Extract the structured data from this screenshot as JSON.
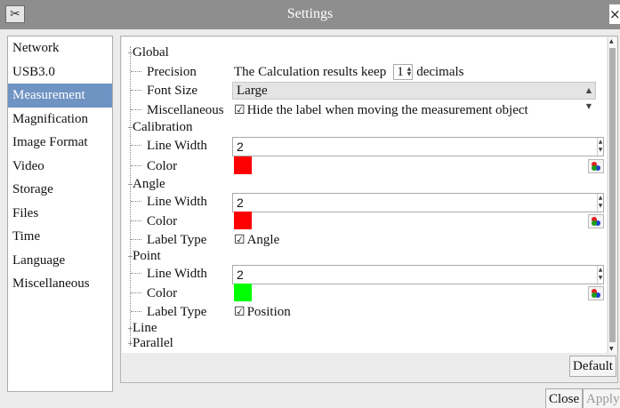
{
  "window": {
    "title": "Settings",
    "sys_icon": "tools-icon",
    "close_glyph": "×"
  },
  "sidebar": {
    "items": [
      {
        "label": "Network"
      },
      {
        "label": "USB3.0"
      },
      {
        "label": "Measurement",
        "selected": true
      },
      {
        "label": "Magnification"
      },
      {
        "label": "Image Format"
      },
      {
        "label": "Video"
      },
      {
        "label": "Storage"
      },
      {
        "label": "Files"
      },
      {
        "label": "Time"
      },
      {
        "label": "Language"
      },
      {
        "label": "Miscellaneous"
      }
    ]
  },
  "global": {
    "title": "Global",
    "precision_label": "Precision",
    "precision_text": "The Calculation results keep",
    "precision_value": "1",
    "precision_unit": "decimals",
    "font_size_label": "Font Size",
    "font_size_value": "Large",
    "misc_label": "Miscellaneous",
    "misc_check": "☑",
    "misc_text": "Hide the label when moving the measurement object"
  },
  "calibration": {
    "title": "Calibration",
    "line_width_label": "Line Width",
    "line_width_value": "2",
    "color_label": "Color",
    "color": "#ff0000"
  },
  "angle": {
    "title": "Angle",
    "line_width_label": "Line Width",
    "line_width_value": "2",
    "color_label": "Color",
    "color": "#ff0000",
    "label_type_label": "Label Type",
    "label_check": "☑",
    "label_type_value": "Angle"
  },
  "point": {
    "title": "Point",
    "line_width_label": "Line Width",
    "line_width_value": "2",
    "color_label": "Color",
    "color": "#00ff00",
    "label_type_label": "Label Type",
    "label_check": "☑",
    "label_type_value": "Position"
  },
  "line": {
    "title": "Line"
  },
  "parallel": {
    "title": "Parallel"
  },
  "buttons": {
    "default": "Default",
    "close": "Close",
    "apply": "Apply"
  },
  "colors": {
    "selected_bg": "#6f93c3",
    "titlebar": "#8e8e8e"
  }
}
